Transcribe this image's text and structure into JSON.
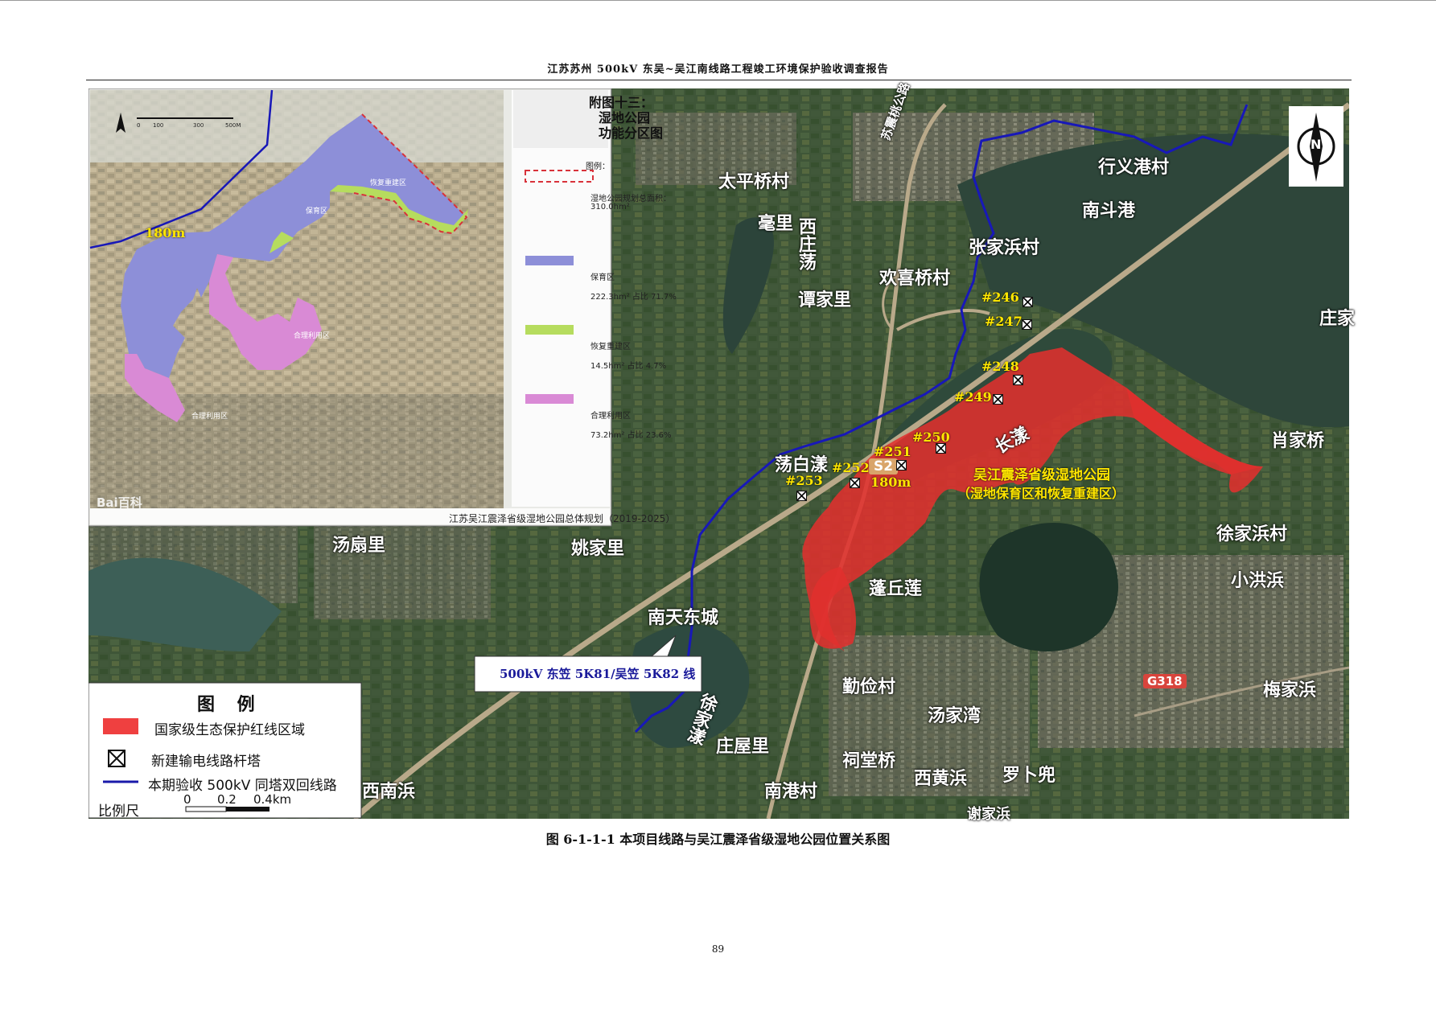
{
  "header": {
    "title": "江苏苏州 500kV 东吴~吴江南线路工程竣工环境保护验收调查报告"
  },
  "main_map": {
    "place_names": {
      "taiping": "太平桥村",
      "haoli": "毫里",
      "xizhuangdang": "西庄荡",
      "tanjiali": "谭家里",
      "huanxi": "欢喜桥村",
      "zhangjiabang": "张家浜村",
      "xingyigang": "行义港村",
      "nandougang": "南斗港",
      "zhuangjia": "庄家",
      "xiaojiaqiao": "肖家桥",
      "xujiabang": "徐家浜村",
      "xiaohongbang": "小洪浜",
      "meijiabang": "梅家浜",
      "dangbaiyang": "荡白漾",
      "tangshanli": "汤扇里",
      "yaojiali": "姚家里",
      "nantiandongcheng": "南天东城",
      "pengqiulian": "蓬丘莲",
      "qinjiancun": "勤俭村",
      "tangjiawan": "汤家湾",
      "xujiayang": "徐家漾",
      "zhuangwuli": "庄屋里",
      "citangqiao": "祠堂桥",
      "xihuangbang": "西黄浜",
      "luobudou": "罗卜兜",
      "xienanbang": "西南浜",
      "nanganghcun": "南港村",
      "xiejiabang": "谢家浜",
      "changyang": "长漾",
      "road_sushen": "苏震桃公路",
      "road_s": "S2",
      "road_g318": "G318"
    },
    "towers": [
      "#246",
      "#247",
      "#248",
      "#249",
      "#250",
      "#251",
      "#252",
      "#253"
    ],
    "distance_label": "180m",
    "wetland_label_1": "吴江震泽省级湿地公园",
    "wetland_label_2": "（湿地保育区和恢复重建区）",
    "line_callout": "500kV 东笠 5K81/吴笠 5K82 线",
    "north_label": "N"
  },
  "inset": {
    "title_lines": [
      "附图十三：",
      "湿地公园",
      "功能分区图"
    ],
    "legend_heading": "图例：",
    "boundary_desc_1": "湿地公园规划总面积：",
    "boundary_desc_2": "310.0hm²",
    "zone1_name": "保育区",
    "zone1_stat": "222.3hm² 占比 71.7%",
    "zone2_name": "恢复重建区",
    "zone2_stat": "14.5hm² 占比 4.7%",
    "zone3_name": "合理利用区",
    "zone3_stat": "73.2hm² 占比 23.6%",
    "source": "江苏吴江震泽省级湿地公园总体规划（2019-2025）",
    "watermark": "Bai百科",
    "distance_label": "180m",
    "scale_ticks": [
      "0",
      "100",
      "300",
      "500M"
    ],
    "map_labels": {
      "baoyu": "保育区",
      "huifu": "恢复重建区",
      "heli_1": "合理利用区",
      "heli_2": "合理利用区"
    },
    "colors": {
      "baoyu": "#8d8fd8",
      "huifu": "#b6dc5e",
      "heli": "#d98ad5",
      "boundary": "#d8323a"
    }
  },
  "legend": {
    "title": "图 例",
    "item1": "国家级生态保护红线区域",
    "item2": "新建输电线路杆塔",
    "item3": "本期验收 500kV 同塔双回线路",
    "scale_label": "比例尺",
    "scale_ticks": [
      "0",
      "0.2",
      "0.4km"
    ],
    "colors": {
      "redline": "#ef4040",
      "line": "#1a1aaa"
    }
  },
  "caption": "图 6-1-1-1 本项目线路与吴江震泽省级湿地公园位置关系图",
  "page_number": "89"
}
